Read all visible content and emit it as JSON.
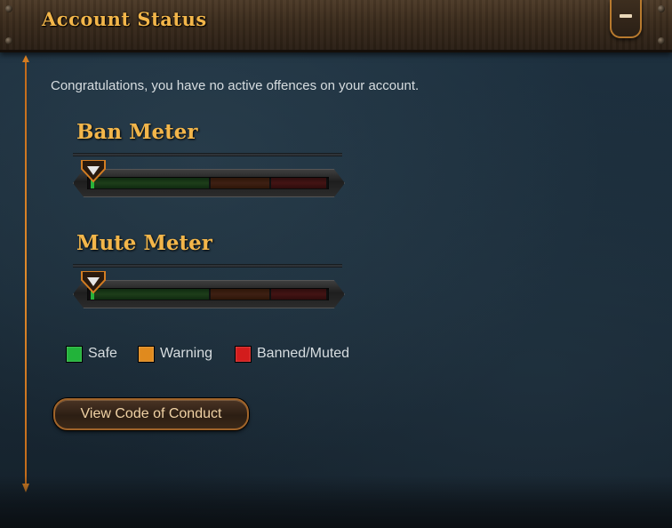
{
  "header": {
    "title": "Account Status",
    "collapse_icon": "minus-icon"
  },
  "intro": "Congratulations, you have no active offences on your account.",
  "meters": [
    {
      "title": "Ban Meter",
      "level": 0.0
    },
    {
      "title": "Mute Meter",
      "level": 0.0
    }
  ],
  "legend": [
    {
      "label": "Safe",
      "color": "#22b33a"
    },
    {
      "label": "Warning",
      "color": "#e08a1e"
    },
    {
      "label": "Banned/Muted",
      "color": "#d31c1c"
    }
  ],
  "colors": {
    "accent": "#f3b64a",
    "border": "#d47d22"
  },
  "button": {
    "label": "View Code of Conduct"
  }
}
